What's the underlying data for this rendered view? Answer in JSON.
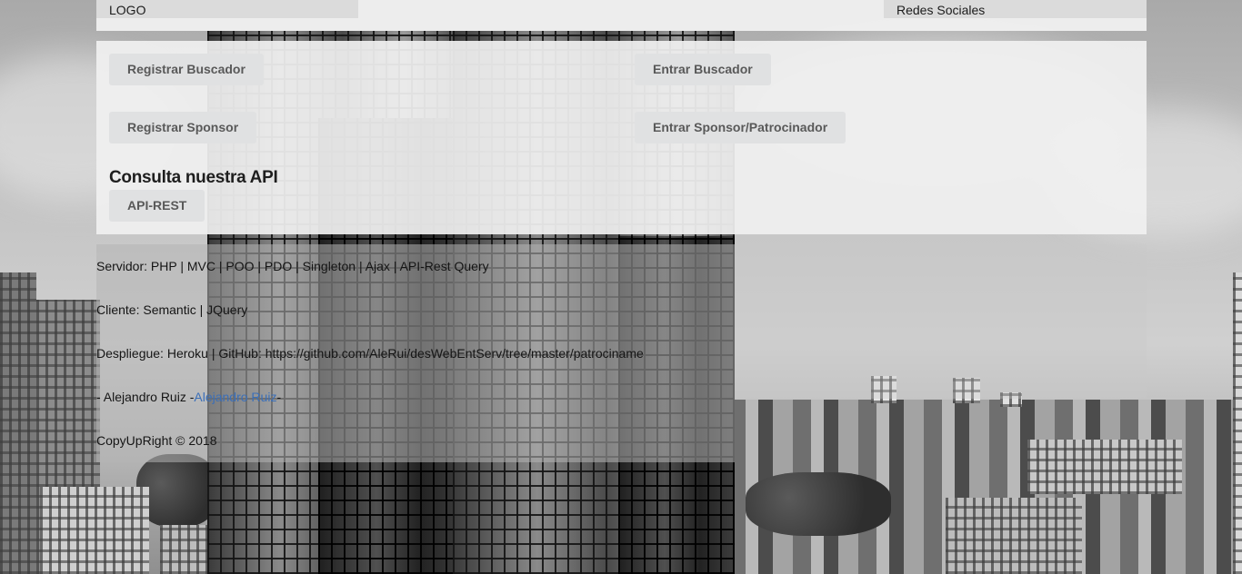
{
  "header": {
    "logo": "LOGO",
    "social": "Redes Sociales"
  },
  "buttons": {
    "register_searcher": "Registrar Buscador",
    "enter_searcher": "Entrar Buscador",
    "register_sponsor": "Registrar Sponsor",
    "enter_sponsor": "Entrar Sponsor/Patrocinador",
    "api_rest": "API-REST"
  },
  "api": {
    "title": "Consulta nuestra API"
  },
  "footer": {
    "server": "Servidor: PHP | MVC | POO | PDO | Singleton | Ajax | API-Rest Query",
    "client": "Cliente: Semantic | JQuery",
    "deploy": "Despliegue: Heroku | GitHub: https://github.com/AleRui/desWebEntServ/tree/master/patrociname",
    "author_prefix": "- Alejandro Ruiz -",
    "author_link": "Alejandro Ruiz",
    "author_suffix": "-",
    "copyright": "CopyUpRight © 2018"
  },
  "colors": {
    "button_bg": "#e0e1e2",
    "button_text": "#595959",
    "link": "#3b6fb8"
  }
}
